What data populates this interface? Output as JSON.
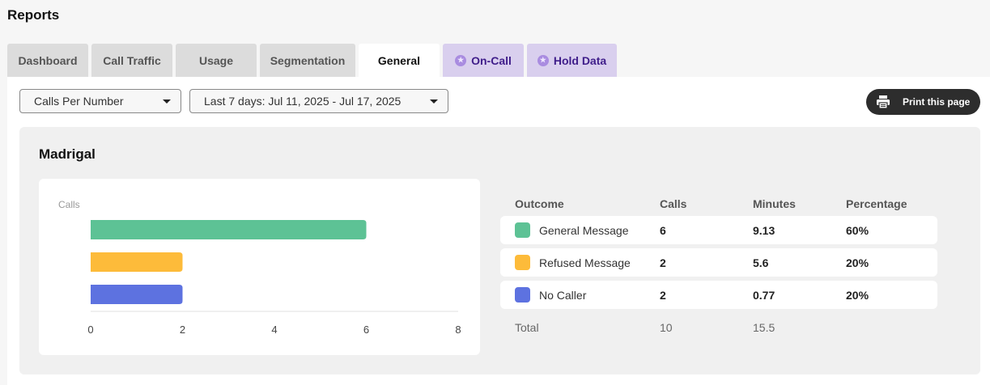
{
  "header": {
    "title": "Reports"
  },
  "tabs": [
    {
      "label": "Dashboard",
      "state": "default"
    },
    {
      "label": "Call Traffic",
      "state": "default"
    },
    {
      "label": "Usage",
      "state": "default"
    },
    {
      "label": "Segmentation",
      "state": "default"
    },
    {
      "label": "General",
      "state": "active"
    },
    {
      "label": "On-Call",
      "state": "premium",
      "icon": "star-icon"
    },
    {
      "label": "Hold Data",
      "state": "premium",
      "icon": "star-icon"
    }
  ],
  "filters": {
    "report_type": "Calls Per Number",
    "date_range": "Last 7 days: Jul 11, 2025 - Jul 17, 2025"
  },
  "toolbar": {
    "print_label": "Print this page",
    "print_icon": "printer-icon"
  },
  "report": {
    "title": "Madrigal",
    "table": {
      "headers": {
        "outcome": "Outcome",
        "calls": "Calls",
        "minutes": "Minutes",
        "percentage": "Percentage"
      },
      "rows": [
        {
          "outcome": "General Message",
          "calls": "6",
          "minutes": "9.13",
          "percentage": "60%",
          "color": "#5dc295"
        },
        {
          "outcome": "Refused Message",
          "calls": "2",
          "minutes": "5.6",
          "percentage": "20%",
          "color": "#fdbb3a"
        },
        {
          "outcome": "No Caller",
          "calls": "2",
          "minutes": "0.77",
          "percentage": "20%",
          "color": "#5d72e0"
        }
      ],
      "total": {
        "label": "Total",
        "calls": "10",
        "minutes": "15.5"
      }
    }
  },
  "chart_data": {
    "type": "bar",
    "orientation": "horizontal",
    "ylabel": "Calls",
    "categories": [
      "General Message",
      "Refused Message",
      "No Caller"
    ],
    "values": [
      6,
      2,
      2
    ],
    "colors": [
      "#5dc295",
      "#fdbb3a",
      "#5d72e0"
    ],
    "xlim": [
      0,
      8
    ],
    "xticks": [
      "0",
      "2",
      "4",
      "6",
      "8"
    ],
    "grid": false,
    "legend": "none"
  }
}
